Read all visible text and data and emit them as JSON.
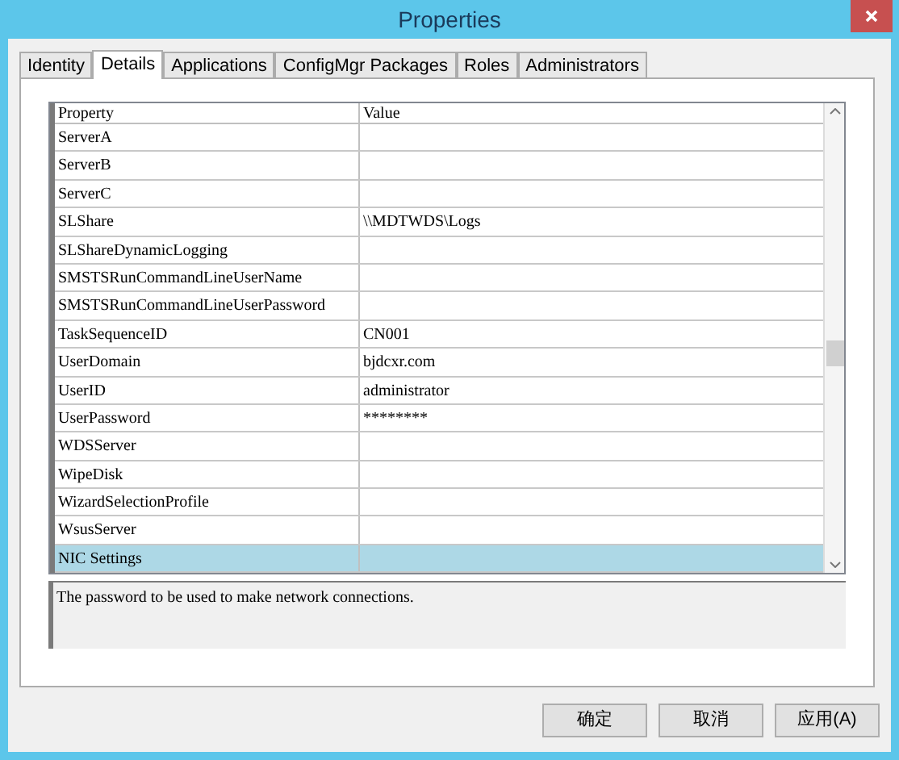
{
  "window": {
    "title": "Properties"
  },
  "tabs": [
    {
      "label": "Identity",
      "selected": false
    },
    {
      "label": "Details",
      "selected": true
    },
    {
      "label": "Applications",
      "selected": false
    },
    {
      "label": "ConfigMgr Packages",
      "selected": false
    },
    {
      "label": "Roles",
      "selected": false
    },
    {
      "label": "Administrators",
      "selected": false
    }
  ],
  "grid": {
    "columns": [
      "Property",
      "Value"
    ],
    "rows": [
      {
        "property": "ServerA",
        "value": "",
        "selected": false
      },
      {
        "property": "ServerB",
        "value": "",
        "selected": false
      },
      {
        "property": "ServerC",
        "value": "",
        "selected": false
      },
      {
        "property": "SLShare",
        "value": "\\\\MDTWDS\\Logs",
        "selected": false
      },
      {
        "property": "SLShareDynamicLogging",
        "value": "",
        "selected": false
      },
      {
        "property": "SMSTSRunCommandLineUserName",
        "value": "",
        "selected": false
      },
      {
        "property": "SMSTSRunCommandLineUserPassword",
        "value": "",
        "selected": false
      },
      {
        "property": "TaskSequenceID",
        "value": "CN001",
        "selected": false
      },
      {
        "property": "UserDomain",
        "value": "bjdcxr.com",
        "selected": false
      },
      {
        "property": "UserID",
        "value": "administrator",
        "selected": false
      },
      {
        "property": "UserPassword",
        "value": "********",
        "selected": false
      },
      {
        "property": "WDSServer",
        "value": "",
        "selected": false
      },
      {
        "property": "WipeDisk",
        "value": "",
        "selected": false
      },
      {
        "property": "WizardSelectionProfile",
        "value": "",
        "selected": false
      },
      {
        "property": "WsusServer",
        "value": "",
        "selected": false
      },
      {
        "property": "NIC Settings",
        "value": "",
        "selected": true
      }
    ]
  },
  "description": "The password to be used to make network connections.",
  "buttons": [
    "确定",
    "取消",
    "应用(A)"
  ]
}
